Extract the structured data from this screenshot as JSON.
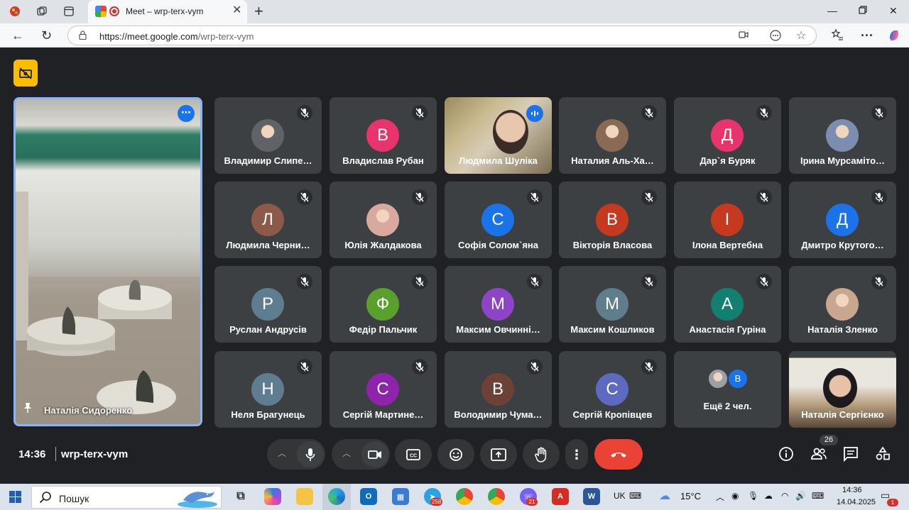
{
  "browser": {
    "tab_title": "Meet – wrp-terx-vym",
    "url_host": "https://meet.google.com",
    "url_path": "/wrp-terx-vym"
  },
  "meet": {
    "pinned_name": "Наталія Сидоренко",
    "participants": [
      {
        "name": "Владимир Слипе…",
        "initial": "",
        "color": "#5f6368",
        "kind": "photo"
      },
      {
        "name": "Владислав Рубан",
        "initial": "В",
        "color": "#e8336d",
        "kind": "letter"
      },
      {
        "name": "Людмила Шуліка",
        "initial": "",
        "color": "",
        "kind": "video"
      },
      {
        "name": "Наталия Аль-Ха…",
        "initial": "",
        "color": "#8a6a55",
        "kind": "photo"
      },
      {
        "name": "Дар`я Буряк",
        "initial": "Д",
        "color": "#e8336d",
        "kind": "letter"
      },
      {
        "name": "Ірина Мурсаміто…",
        "initial": "",
        "color": "#7a8fb0",
        "kind": "photo"
      },
      {
        "name": "Людмила Черни…",
        "initial": "Л",
        "color": "#8d5a4a",
        "kind": "letter"
      },
      {
        "name": "Юлія Жалдакова",
        "initial": "",
        "color": "#d9a9a0",
        "kind": "photo"
      },
      {
        "name": "Софія Солом`яна",
        "initial": "С",
        "color": "#1a73e8",
        "kind": "letter"
      },
      {
        "name": "Вікторія Власова",
        "initial": "В",
        "color": "#c5391f",
        "kind": "letter"
      },
      {
        "name": "Ілона Вертебна",
        "initial": "І",
        "color": "#c5391f",
        "kind": "letter"
      },
      {
        "name": "Дмитро Крутого…",
        "initial": "Д",
        "color": "#1a73e8",
        "kind": "letter"
      },
      {
        "name": "Руслан Андрусів",
        "initial": "Р",
        "color": "#5e7d91",
        "kind": "letter"
      },
      {
        "name": "Федір Пальчик",
        "initial": "Ф",
        "color": "#5aa02c",
        "kind": "letter"
      },
      {
        "name": "Максим Овчинні…",
        "initial": "М",
        "color": "#8e44c7",
        "kind": "letter"
      },
      {
        "name": "Максим Кошликов",
        "initial": "М",
        "color": "#607d8b",
        "kind": "letter"
      },
      {
        "name": "Анастасія Гуріна",
        "initial": "А",
        "color": "#12806f",
        "kind": "letter"
      },
      {
        "name": "Наталія Зленко",
        "initial": "",
        "color": "#c9a78f",
        "kind": "photo"
      },
      {
        "name": "Неля Брагунець",
        "initial": "Н",
        "color": "#5e7d91",
        "kind": "letter"
      },
      {
        "name": "Сергій Мартине…",
        "initial": "С",
        "color": "#8e24aa",
        "kind": "letter"
      },
      {
        "name": "Володимир Чума…",
        "initial": "В",
        "color": "#6d4236",
        "kind": "letter"
      },
      {
        "name": "Сергій Кропівцев",
        "initial": "С",
        "color": "#5c6bc0",
        "kind": "letter"
      },
      {
        "name": "Ещё 2 чел.",
        "initial": "В",
        "color": "#1a73e8",
        "kind": "more"
      },
      {
        "name": "Наталія Сергієнко",
        "initial": "",
        "color": "",
        "kind": "video2"
      }
    ],
    "clock": "14:36",
    "meeting_code": "wrp-terx-vym",
    "participant_count": "26",
    "end_color": "#ea4335",
    "accent_color": "#1a73e8"
  },
  "taskbar": {
    "search_placeholder": "Пошук",
    "lang": "UK",
    "weather": "15°C",
    "time": "14:36",
    "date": "14.04.2025",
    "telegram_badge": "258",
    "viber_badge": "21",
    "notif_badge": "1"
  }
}
